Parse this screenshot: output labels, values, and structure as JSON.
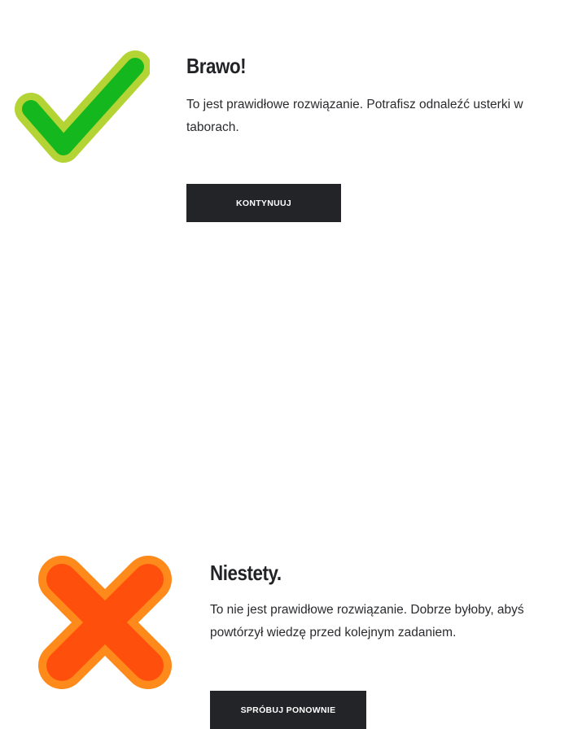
{
  "success": {
    "icon": "checkmark-icon",
    "title": "Brawo!",
    "message": "To jest prawidłowe rozwiązanie. Potrafisz odnaleźć usterki w taborach.",
    "button_label": "KONTYNUUJ",
    "colors": {
      "icon_fill": "#15b71f",
      "icon_outline": "#b4d334",
      "button_bg": "#232428",
      "button_text": "#ffffff"
    }
  },
  "failure": {
    "icon": "cross-icon",
    "title": "Niestety.",
    "message": "To nie jest prawidłowe rozwiązanie. Dobrze byłoby, abyś powtórzył wiedzę przed kolejnym zadaniem.",
    "button_label": "SPRÓBUJ PONOWNIE",
    "colors": {
      "icon_fill": "#ff4f0c",
      "icon_outline": "#ff8a1c",
      "button_bg": "#232428",
      "button_text": "#ffffff"
    }
  }
}
